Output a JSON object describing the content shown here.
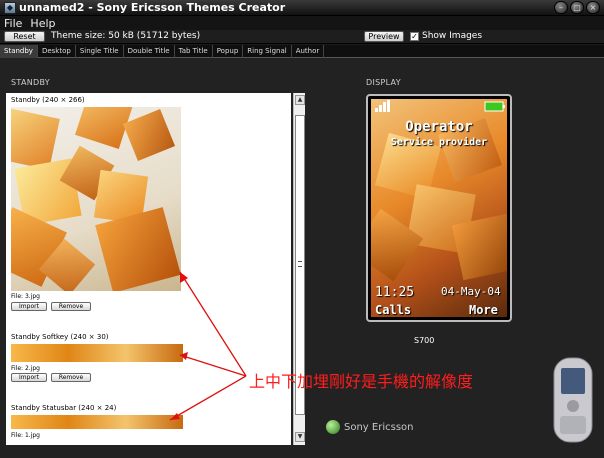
{
  "titlebar": {
    "title": "unnamed2 - Sony Ericsson Themes Creator",
    "app_icon": "app-icon",
    "controls": [
      "minimize-icon",
      "maximize-icon",
      "close-icon"
    ]
  },
  "menu": {
    "items": [
      "File",
      "Help"
    ]
  },
  "toolbar": {
    "reset_label": "Reset",
    "theme_size": "Theme size: 50 kB (51712 bytes)",
    "preview_label": "Preview",
    "show_images_label": "Show Images",
    "show_images_checked": true
  },
  "tabs": [
    "Standby",
    "Desktop",
    "Single Title",
    "Double Title",
    "Tab Title",
    "Popup",
    "Ring Signal",
    "Author"
  ],
  "active_tab": "Standby",
  "standby": {
    "section_label": "STANDBY",
    "items": [
      {
        "title": "Standby (240 × 266)",
        "file": "File: 3.jpg",
        "import": "Import",
        "remove": "Remove"
      },
      {
        "title": "Standby Softkey (240 × 30)",
        "file": "File: 2.jpg",
        "import": "Import",
        "remove": "Remove"
      },
      {
        "title": "Standby Statusbar (240 × 24)",
        "file": "File: 1.jpg"
      }
    ]
  },
  "annotation": "上中下加埋剛好是手機的解像度",
  "display": {
    "section_label": "DISPLAY",
    "operator": "Operator",
    "provider": "Service provider",
    "time": "11:25",
    "date": "04-May-04",
    "left_softkey": "Calls",
    "right_softkey": "More",
    "model": "S700",
    "brand": "Sony Ericsson"
  },
  "colors": {
    "annotation": "#ff1d1d",
    "cube": "#f0961e",
    "battery": "#3ec81e"
  }
}
